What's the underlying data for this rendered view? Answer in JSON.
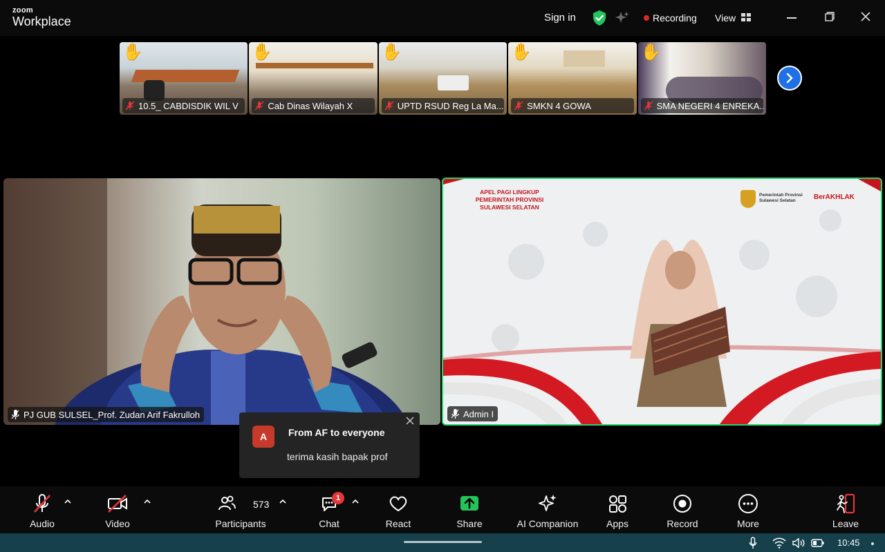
{
  "app": {
    "brand_top": "zoom",
    "brand_bottom": "Workplace"
  },
  "header": {
    "sign_in": "Sign in",
    "recording": "Recording",
    "view": "View"
  },
  "thumbnails": [
    {
      "name": "10.5_ CABDISDIK WIL V",
      "hand_raised": true,
      "muted": true
    },
    {
      "name": "Cab Dinas Wilayah X",
      "hand_raised": true,
      "muted": true
    },
    {
      "name": "UPTD RSUD Reg La Ma...",
      "hand_raised": true,
      "muted": true
    },
    {
      "name": "SMKN 4 GOWA",
      "hand_raised": true,
      "muted": true
    },
    {
      "name": "SMA NEGERI 4 ENREKA...",
      "hand_raised": true,
      "muted": true
    }
  ],
  "tiles": {
    "left": {
      "name": "PJ GUB SULSEL_Prof. Zudan Arif Fakrulloh"
    },
    "right": {
      "name": "Admin I",
      "banner_title": [
        "APEL PAGI LINGKUP",
        "PEMERINTAH PROVINSI",
        "SULAWESI SELATAN"
      ],
      "org_name": [
        "Pemerintah Provinsi",
        "Sulawesi Selatan"
      ],
      "berakhlak": "BerAKHLAK"
    }
  },
  "toast": {
    "avatar": "A",
    "from": "From AF to everyone",
    "message": "terima kasih bapak prof"
  },
  "toolbar": {
    "audio": "Audio",
    "video": "Video",
    "participants": "Participants",
    "participants_count": "573",
    "chat": "Chat",
    "chat_badge": "1",
    "react": "React",
    "share": "Share",
    "ai_companion": "AI Companion",
    "apps": "Apps",
    "record": "Record",
    "more": "More",
    "leave": "Leave"
  },
  "taskbar": {
    "time": "10:45"
  },
  "colors": {
    "active_speaker": "#25d36b",
    "share_green": "#25c45a",
    "leave_red": "#e5363a",
    "accent_blue": "#1f6fe5"
  }
}
